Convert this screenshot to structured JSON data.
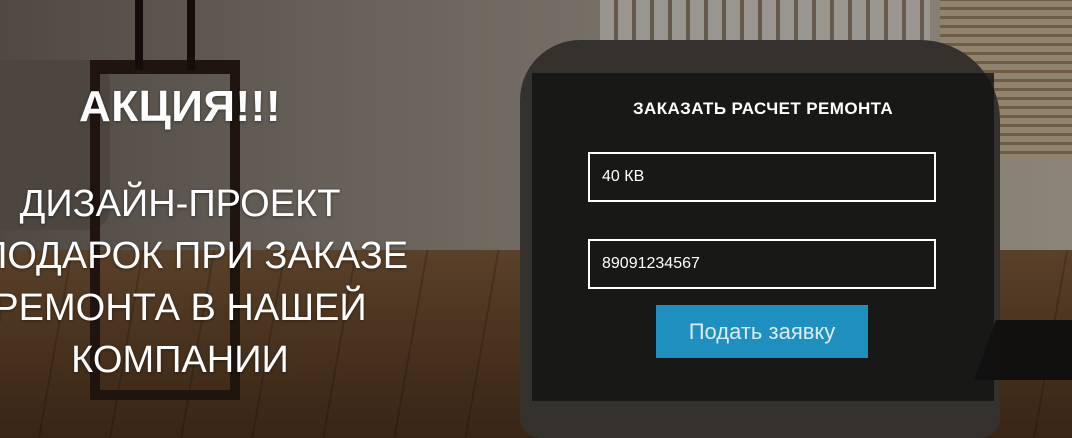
{
  "promo": {
    "title": "АКЦИЯ!!!",
    "lines": [
      "ДИЗАЙН-ПРОЕКТ",
      "ПОДАРОК ПРИ ЗАКАЗЕ",
      "РЕМОНТА В НАШЕЙ",
      "КОМПАНИИ"
    ]
  },
  "form": {
    "title": "ЗАКАЗАТЬ РАСЧЕТ РЕМОНТА",
    "area_value": "40 КВ",
    "phone_value": "89091234567",
    "submit_label": "Подать заявку"
  },
  "colors": {
    "button_bg": "#1f8fbf",
    "panel_bg": "rgba(18,18,18,0.82)"
  }
}
